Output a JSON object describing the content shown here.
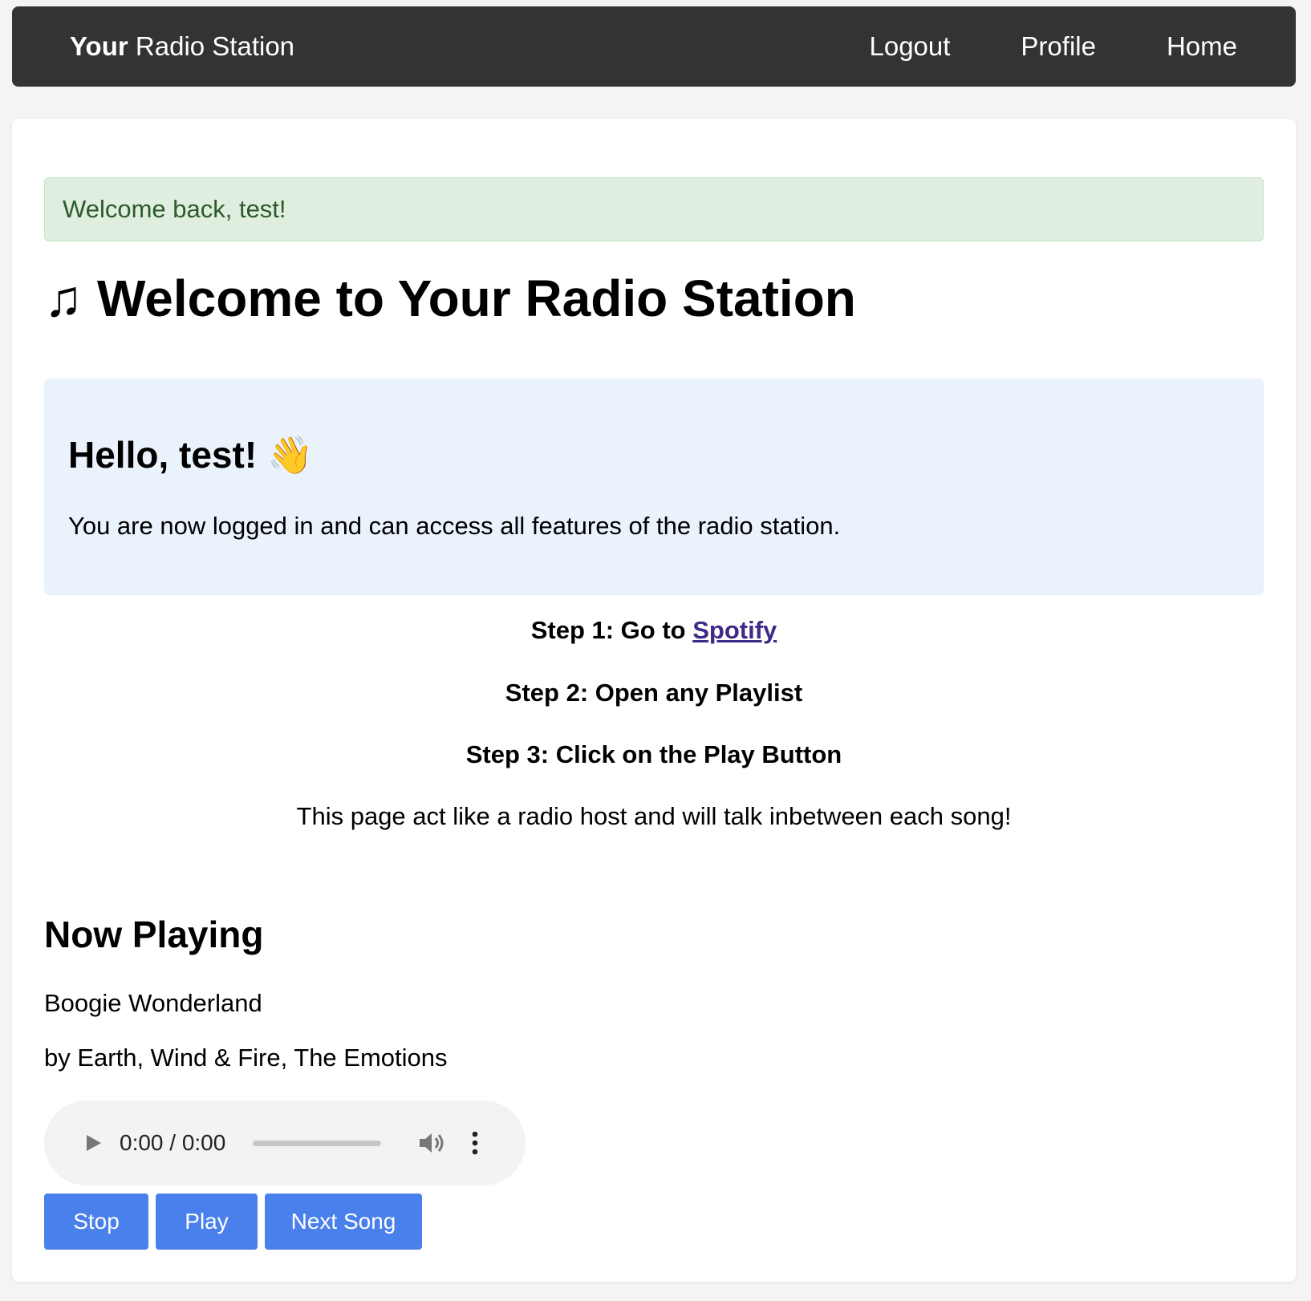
{
  "navbar": {
    "brand_bold": "Your",
    "brand_rest": " Radio Station",
    "links": [
      "Logout",
      "Profile",
      "Home"
    ],
    "background": "#333333"
  },
  "alert": {
    "message": "Welcome back, test!",
    "background": "#dfeede",
    "text_color": "#2c5a2c"
  },
  "page": {
    "title_icon": "♫",
    "title": "Welcome to Your Radio Station"
  },
  "hello": {
    "title": "Hello, test!",
    "wave_icon": "👋",
    "message": "You are now logged in and can access all features of the radio station.",
    "background": "#eaf2fc"
  },
  "steps": {
    "step1_prefix": "Step 1: Go to ",
    "step1_link": "Spotify",
    "step2": "Step 2: Open any Playlist",
    "step3": "Step 3: Click on the Play Button",
    "note": "This page act like a radio host and will talk inbetween each song!"
  },
  "now_playing": {
    "heading": "Now Playing",
    "song": "Boogie Wonderland",
    "artist": "by Earth, Wind & Fire, The Emotions"
  },
  "player": {
    "time": "0:00 / 0:00",
    "progress": 0,
    "icons": [
      "play-icon",
      "volume-icon",
      "more-vertical-icon"
    ]
  },
  "buttons": {
    "stop": "Stop",
    "play": "Play",
    "next": "Next Song",
    "color": "#4a80ec"
  }
}
